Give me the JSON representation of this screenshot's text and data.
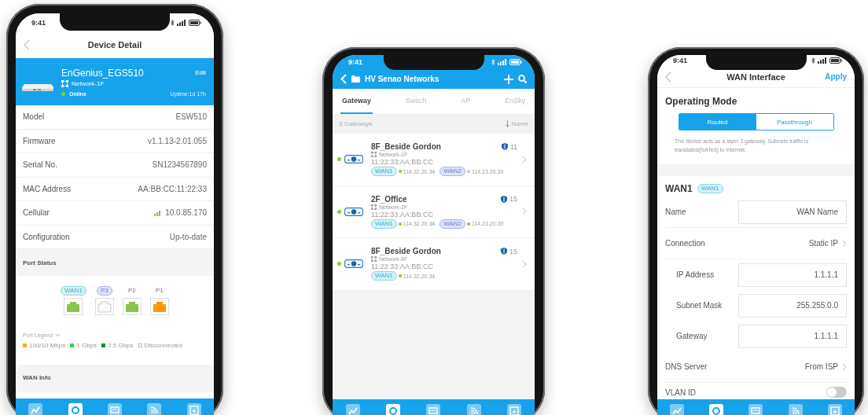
{
  "phones": [
    {
      "kind": "device_detail",
      "status_bar": {
        "time": "9:41"
      },
      "header": {
        "title": "Device Detail"
      },
      "device_card": {
        "name": "EnGenius_EGS510",
        "action": "Edit",
        "network": "Network-1F",
        "online": true,
        "status": "Online",
        "uptime": "Uptime:1d 17h"
      },
      "details": [
        {
          "label": "Model",
          "value": "ESW510",
          "kind": "text"
        },
        {
          "label": "Firmware",
          "value": "v1.1.13-2.01.055",
          "kind": "text"
        },
        {
          "label": "Serial No.",
          "value": "SN1234567890",
          "kind": "text"
        },
        {
          "label": "MAC Address",
          "value": "AA:BB:CC:11:22:33",
          "kind": "text"
        },
        {
          "label": "Cellular",
          "value": "10.0.85.170",
          "kind": "signal"
        },
        {
          "label": "Configuration",
          "value": "Up-to-date",
          "kind": "text"
        }
      ],
      "port_status": {
        "title": "Port Status",
        "ports": [
          {
            "label": "WAN1",
            "kind": "wan",
            "color": "#8bc34a"
          },
          {
            "label": "P3",
            "kind": "lan"
          },
          {
            "label": "P2",
            "kind": "plain",
            "color": "#8bc34a"
          },
          {
            "label": "P1",
            "kind": "plain",
            "color": "#ff9800"
          }
        ],
        "legend_title": "Port Legend",
        "legend": [
          {
            "label": "100/10 Mbps",
            "color": "#ffa726"
          },
          {
            "label": "1 Gbps",
            "color": "#3ccf4e"
          },
          {
            "label": "2.5 Gbps",
            "color": "#1b8a2e"
          },
          {
            "label": "Disconnected"
          }
        ]
      },
      "wan_info": {
        "title": "WAN Info"
      },
      "tab_bar": [
        {
          "selected": false
        },
        {
          "selected": true
        },
        {
          "selected": false
        },
        {
          "selected": false
        },
        {
          "selected": false
        }
      ]
    },
    {
      "kind": "gateway_list",
      "status_bar": {
        "time": "9:41"
      },
      "header": {
        "title": "HV Senao Networks"
      },
      "tabs": [
        {
          "label": "Gateway",
          "selected": true
        },
        {
          "label": "Switch",
          "selected": false
        },
        {
          "label": "AP",
          "selected": false
        },
        {
          "label": "EnSky",
          "selected": false
        }
      ],
      "summary": "3 Gateways",
      "sort": "Name",
      "gateways": [
        {
          "name": "8F_Beside Gordon",
          "online": true,
          "clients": "11",
          "network": "Network-1F",
          "mac": "11:22:33:AA:BB:CC",
          "wans": [
            {
              "label": "WAN1",
              "kind": "wan1",
              "up": true,
              "ip": "114.32.20.34"
            },
            {
              "label": "WAN2",
              "kind": "wan2",
              "up": false,
              "ip": "114.23.20.30"
            }
          ]
        },
        {
          "name": "2F_Office",
          "online": true,
          "clients": "15",
          "network": "Network-2F",
          "mac": "11:22:33:AA:BB:CC",
          "wans": [
            {
              "label": "WAN1",
              "kind": "wan1",
              "up": true,
              "ip": "114.32.20.34"
            },
            {
              "label": "WAN2",
              "kind": "wan2",
              "up": true,
              "ip": "114.23.20.30"
            }
          ]
        },
        {
          "name": "8F_Beside Gordon",
          "online": true,
          "clients": "15",
          "network": "Network-8F",
          "mac": "11:22:33:AA:BB:CC",
          "wans": [
            {
              "label": "WAN1",
              "kind": "wan1",
              "up": true,
              "ip": "114.32.20.34"
            }
          ]
        }
      ],
      "tab_bar": [
        {
          "selected": false
        },
        {
          "selected": true
        },
        {
          "selected": false
        },
        {
          "selected": false
        },
        {
          "selected": false
        }
      ]
    },
    {
      "kind": "wan_interface",
      "status_bar": {
        "time": "9:41"
      },
      "header": {
        "title": "WAN Interface",
        "action": "Apply"
      },
      "operating_mode": {
        "title": "Operating Mode",
        "options": [
          {
            "label": "Routed",
            "selected": true
          },
          {
            "label": "Passthrough",
            "selected": false
          }
        ],
        "description": "The device acts as a layer 3 gateway. Subnets traffic is translated(NATed) to internet."
      },
      "wan": {
        "title": "WAN1",
        "tag": "WAN1",
        "rows": [
          {
            "label": "Name",
            "kind": "input",
            "value": "WAN Name"
          },
          {
            "label": "Connection",
            "kind": "select",
            "value": "Static IP",
            "children": [
              {
                "label": "IP Address",
                "kind": "input",
                "value": "1.1.1.1"
              },
              {
                "label": "Subnet Mask",
                "kind": "input",
                "value": "255.255.0.0"
              },
              {
                "label": "Gateway",
                "kind": "input",
                "value": "1.1.1.1"
              }
            ]
          },
          {
            "label": "DNS Server",
            "kind": "select",
            "value": "From ISP"
          },
          {
            "label": "VLAN ID",
            "kind": "toggle",
            "on": false
          }
        ]
      },
      "tab_bar": [
        {
          "selected": false
        },
        {
          "selected": true
        },
        {
          "selected": false
        },
        {
          "selected": false
        },
        {
          "selected": false
        }
      ]
    }
  ]
}
